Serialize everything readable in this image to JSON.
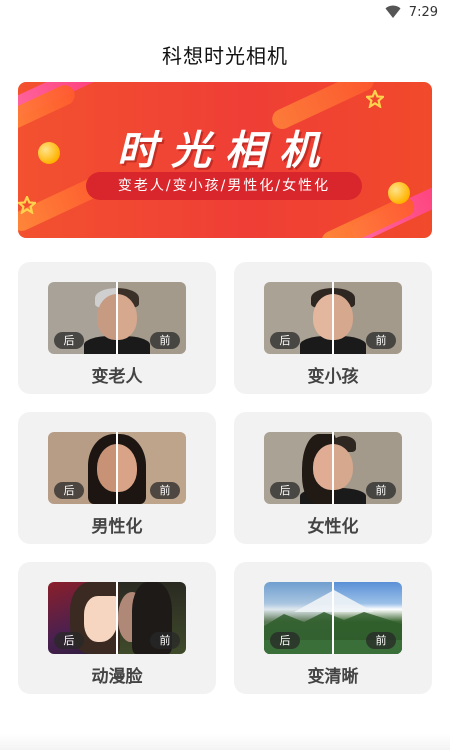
{
  "status_bar": {
    "time": "7:29",
    "wifi_icon": "wifi-icon"
  },
  "app": {
    "title": "科想时光相机"
  },
  "banner": {
    "title": "时光相机",
    "subtitle": "变老人/变小孩/男性化/女性化",
    "colors": {
      "background": "#ef3e36",
      "pill": "#d8262c"
    }
  },
  "features": [
    {
      "label": "变老人",
      "after_tag": "后",
      "before_tag": "前"
    },
    {
      "label": "变小孩",
      "after_tag": "后",
      "before_tag": "前"
    },
    {
      "label": "男性化",
      "after_tag": "后",
      "before_tag": "前"
    },
    {
      "label": "女性化",
      "after_tag": "后",
      "before_tag": "前"
    },
    {
      "label": "动漫脸",
      "after_tag": "后",
      "before_tag": "前"
    },
    {
      "label": "变清晰",
      "after_tag": "后",
      "before_tag": "前"
    }
  ]
}
